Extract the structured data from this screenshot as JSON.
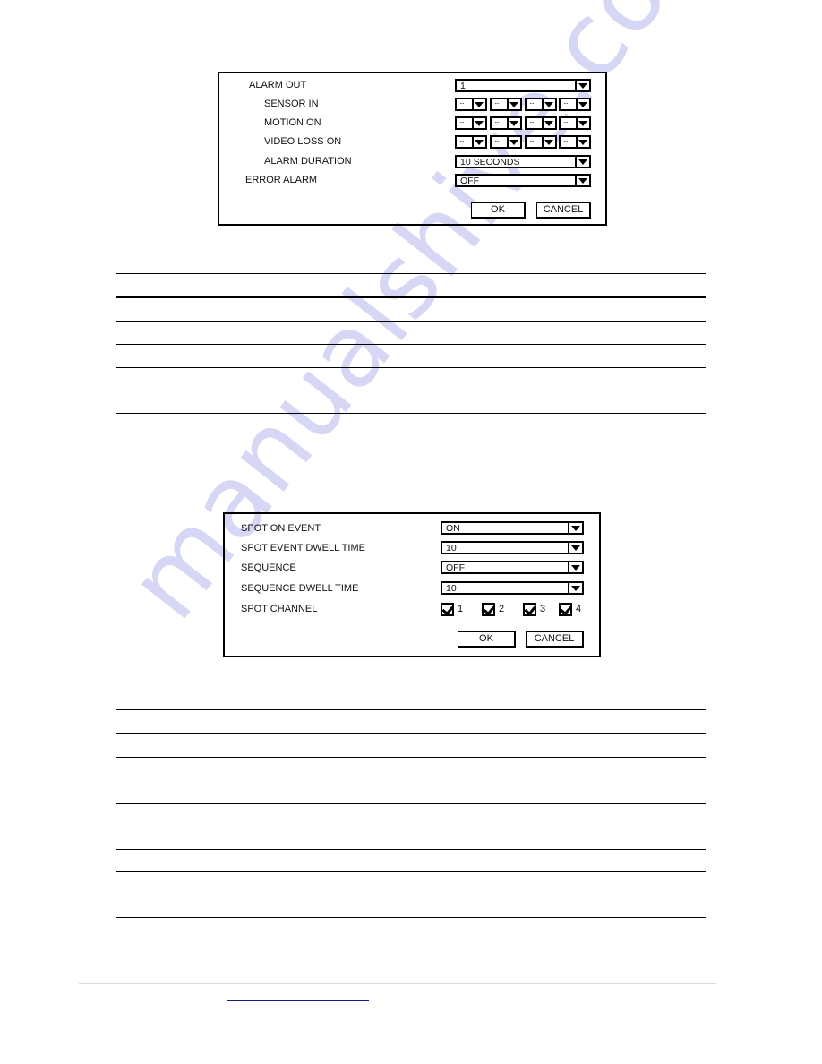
{
  "watermark": {
    "text": "manualshive.com",
    "color": "#c9c9f2"
  },
  "alarm_dialog": {
    "rows": [
      {
        "label": "ALARM OUT",
        "value": "1"
      },
      {
        "label": "SENSOR IN",
        "values": [
          "···",
          "···",
          "···",
          "···"
        ]
      },
      {
        "label": "MOTION ON",
        "values": [
          "···",
          "···",
          "···",
          "···"
        ]
      },
      {
        "label": "VIDEO LOSS ON",
        "values": [
          "···",
          "···",
          "···",
          "···"
        ]
      },
      {
        "label": "ALARM DURATION",
        "value": "10 SECONDS"
      },
      {
        "label": "ERROR ALARM",
        "value": "OFF"
      }
    ],
    "ok_label": "OK",
    "cancel_label": "CANCEL"
  },
  "spot_dialog": {
    "rows": [
      {
        "label": "SPOT ON EVENT",
        "value": "ON"
      },
      {
        "label": "SPOT EVENT DWELL TIME",
        "value": "10"
      },
      {
        "label": "SEQUENCE",
        "value": "OFF"
      },
      {
        "label": "SEQUENCE DWELL TIME",
        "value": "10"
      },
      {
        "label": "SPOT CHANNEL"
      }
    ],
    "channels": [
      {
        "label": "1",
        "checked": true
      },
      {
        "label": "2",
        "checked": true
      },
      {
        "label": "3",
        "checked": true
      },
      {
        "label": "4",
        "checked": true
      }
    ],
    "ok_label": "OK",
    "cancel_label": "CANCEL"
  },
  "footer": {
    "link_text": "",
    "link_color": "#1a1a8c"
  }
}
